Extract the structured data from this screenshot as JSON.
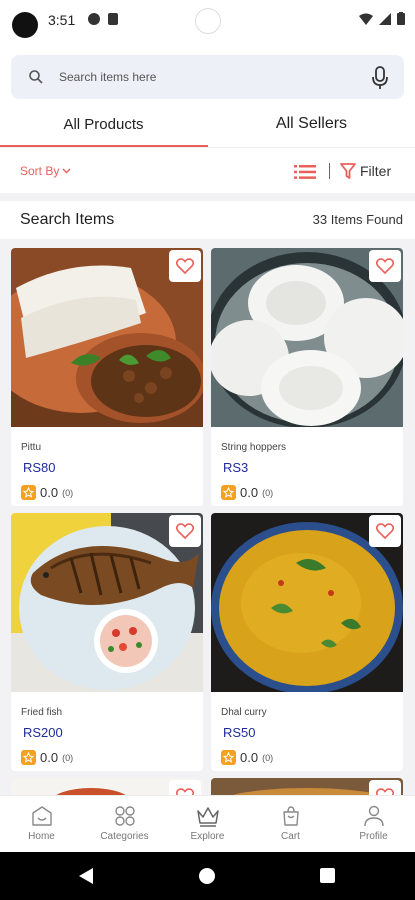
{
  "status_bar": {
    "time": "3:51"
  },
  "search": {
    "placeholder": "Search items here"
  },
  "tabs": [
    {
      "label": "All Products",
      "active": true
    },
    {
      "label": "All Sellers",
      "active": false
    }
  ],
  "toolbar": {
    "sort_label": "Sort By",
    "filter_label": "Filter"
  },
  "results": {
    "title": "Search Items",
    "count_text": "33 Items Found"
  },
  "products": [
    {
      "name": "Pittu",
      "price": "RS80",
      "rating": "0.0",
      "rating_count": "(0)"
    },
    {
      "name": "String hoppers",
      "price": "RS3",
      "rating": "0.0",
      "rating_count": "(0)"
    },
    {
      "name": "Fried fish",
      "price": "RS200",
      "rating": "0.0",
      "rating_count": "(0)"
    },
    {
      "name": "Dhal curry",
      "price": "RS50",
      "rating": "0.0",
      "rating_count": "(0)"
    }
  ],
  "bottom_nav": [
    {
      "label": "Home",
      "icon": "home-icon"
    },
    {
      "label": "Categories",
      "icon": "categories-icon"
    },
    {
      "label": "Explore",
      "icon": "crown-icon",
      "active": true
    },
    {
      "label": "Cart",
      "icon": "cart-icon"
    },
    {
      "label": "Profile",
      "icon": "profile-icon"
    }
  ],
  "colors": {
    "accent": "#e8605a",
    "price": "#1e2c9c",
    "star": "#f4a020"
  }
}
